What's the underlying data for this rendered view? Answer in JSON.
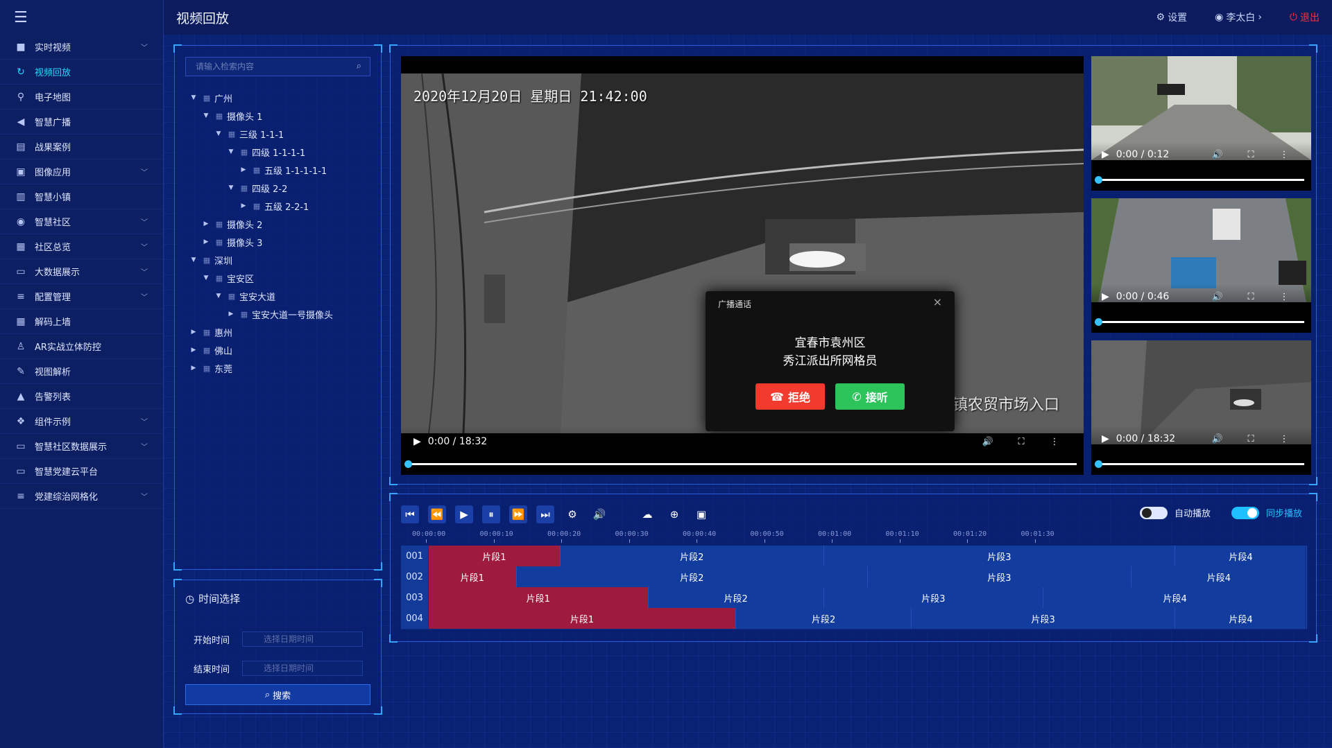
{
  "menu_icon": "hamburger-icon",
  "sidebar": {
    "items": [
      {
        "label": "实时视频",
        "icon": "video-camera-icon",
        "expandable": true,
        "active": false
      },
      {
        "label": "视频回放",
        "icon": "replay-icon",
        "expandable": false,
        "active": true
      },
      {
        "label": "电子地图",
        "icon": "map-pin-icon",
        "expandable": false,
        "active": false
      },
      {
        "label": "智慧广播",
        "icon": "megaphone-icon",
        "expandable": false,
        "active": false
      },
      {
        "label": "战果案例",
        "icon": "document-icon",
        "expandable": false,
        "active": false
      },
      {
        "label": "图像应用",
        "icon": "image-icon",
        "expandable": true,
        "active": false
      },
      {
        "label": "智慧小镇",
        "icon": "building-icon",
        "expandable": false,
        "active": false
      },
      {
        "label": "智慧社区",
        "icon": "people-icon",
        "expandable": true,
        "active": false
      },
      {
        "label": "社区总览",
        "icon": "office-icon",
        "expandable": true,
        "active": false
      },
      {
        "label": "大数据展示",
        "icon": "monitor-icon",
        "expandable": true,
        "active": false
      },
      {
        "label": "配置管理",
        "icon": "sliders-icon",
        "expandable": true,
        "active": false
      },
      {
        "label": "解码上墙",
        "icon": "grid-icon",
        "expandable": false,
        "active": false
      },
      {
        "label": "AR实战立体防控",
        "icon": "person-icon",
        "expandable": false,
        "active": false
      },
      {
        "label": "视图解析",
        "icon": "magic-wand-icon",
        "expandable": false,
        "active": false
      },
      {
        "label": "告警列表",
        "icon": "warning-icon",
        "expandable": false,
        "active": false
      },
      {
        "label": "组件示例",
        "icon": "component-icon",
        "expandable": true,
        "active": false
      },
      {
        "label": "智慧社区数据展示",
        "icon": "monitor-icon",
        "expandable": true,
        "active": false
      },
      {
        "label": "智慧党建云平台",
        "icon": "monitor-icon",
        "expandable": false,
        "active": false
      },
      {
        "label": "党建综治网格化",
        "icon": "sliders-icon",
        "expandable": true,
        "active": false
      }
    ]
  },
  "header": {
    "title": "视频回放",
    "settings_label": "设置",
    "user_label": "李太白",
    "logout_label": "退出"
  },
  "tree": {
    "search_placeholder": "请输入检索内容",
    "nodes": [
      {
        "label": "广州",
        "level": 0,
        "expanded": true
      },
      {
        "label": "摄像头 1",
        "level": 1,
        "expanded": true
      },
      {
        "label": "三级 1-1-1",
        "level": 2,
        "expanded": true
      },
      {
        "label": "四级 1-1-1-1",
        "level": 3,
        "expanded": true
      },
      {
        "label": "五级 1-1-1-1-1",
        "level": 4,
        "expanded": false
      },
      {
        "label": "四级 2-2",
        "level": 3,
        "expanded": true
      },
      {
        "label": "五级 2-2-1",
        "level": 4,
        "expanded": false
      },
      {
        "label": "摄像头 2",
        "level": 1,
        "expanded": false
      },
      {
        "label": "摄像头 3",
        "level": 1,
        "expanded": false
      },
      {
        "label": "深圳",
        "level": 0,
        "expanded": true
      },
      {
        "label": "宝安区",
        "level": 1,
        "expanded": true
      },
      {
        "label": "宝安大道",
        "level": 2,
        "expanded": true
      },
      {
        "label": "宝安大道一号摄像头",
        "level": 3,
        "expanded": false
      },
      {
        "label": "惠州",
        "level": 0,
        "expanded": false
      },
      {
        "label": "佛山",
        "level": 0,
        "expanded": false
      },
      {
        "label": "东莞",
        "level": 0,
        "expanded": false
      }
    ]
  },
  "time_select": {
    "title": "时间选择",
    "start_label": "开始时间",
    "end_label": "结束时间",
    "start_placeholder": "选择日期时间",
    "end_placeholder": "选择日期时间",
    "search_label": "搜索"
  },
  "main_video": {
    "osd_time": "2020年12月20日  星期日  21:42:00",
    "osd_place": "慈化镇农贸市场入口",
    "time": "0:00 / 18:32",
    "progress": 0
  },
  "thumbs": [
    {
      "time": "0:00 / 0:12",
      "progress": 0
    },
    {
      "time": "0:00 / 0:46",
      "progress": 0
    },
    {
      "time": "0:00 / 18:32",
      "progress": 0
    }
  ],
  "dialog": {
    "title": "广播通话",
    "line1": "宜春市袁州区",
    "line2": "秀江派出所网格员",
    "reject_label": "拒绝",
    "accept_label": "接听"
  },
  "toolbar": {
    "auto_play_label": "自动播放",
    "sync_play_label": "同步播放",
    "auto_play": false,
    "sync_play": true
  },
  "timeline": {
    "ticks": [
      "00:00:00",
      "00:00:10",
      "00:00:20",
      "00:00:30",
      "00:00:40",
      "00:00:50",
      "00:01:00",
      "00:01:10",
      "00:01:20",
      "00:01:30"
    ],
    "rows": [
      {
        "id": "001",
        "segments": [
          {
            "label": "片段1",
            "start": 0,
            "end": 15,
            "active": true
          },
          {
            "label": "片段2",
            "start": 15,
            "end": 45
          },
          {
            "label": "片段3",
            "start": 45,
            "end": 85
          },
          {
            "label": "片段4",
            "start": 85,
            "end": 100
          }
        ]
      },
      {
        "id": "002",
        "segments": [
          {
            "label": "片段1",
            "start": 0,
            "end": 10,
            "active": true
          },
          {
            "label": "片段2",
            "start": 10,
            "end": 50
          },
          {
            "label": "片段3",
            "start": 50,
            "end": 80
          },
          {
            "label": "片段4",
            "start": 80,
            "end": 100
          }
        ]
      },
      {
        "id": "003",
        "segments": [
          {
            "label": "片段1",
            "start": 0,
            "end": 25,
            "active": true
          },
          {
            "label": "片段2",
            "start": 25,
            "end": 45
          },
          {
            "label": "片段3",
            "start": 45,
            "end": 70
          },
          {
            "label": "片段4",
            "start": 70,
            "end": 100
          }
        ]
      },
      {
        "id": "004",
        "segments": [
          {
            "label": "片段1",
            "start": 0,
            "end": 35,
            "active": true
          },
          {
            "label": "片段2",
            "start": 35,
            "end": 55
          },
          {
            "label": "片段3",
            "start": 55,
            "end": 85
          },
          {
            "label": "片段4",
            "start": 85,
            "end": 100
          }
        ]
      }
    ]
  }
}
